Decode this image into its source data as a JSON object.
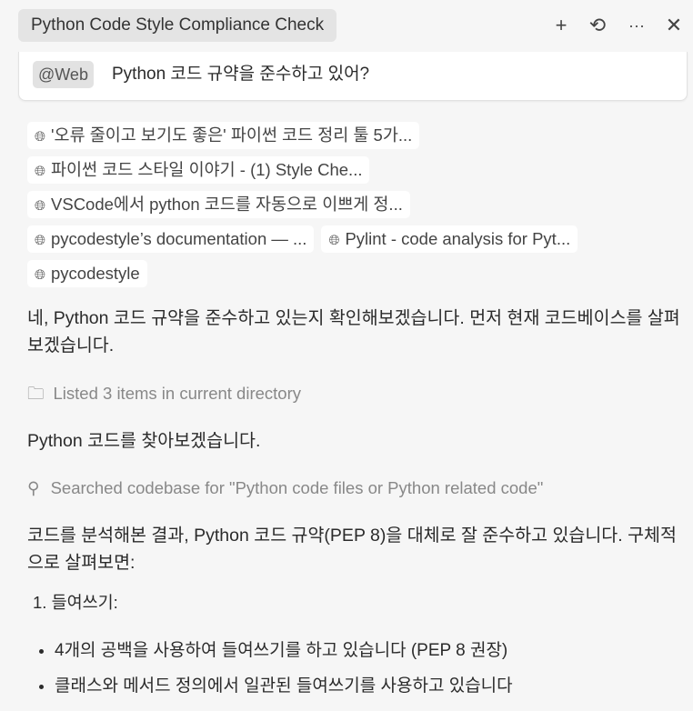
{
  "header": {
    "title": "Python Code Style Compliance Check",
    "icons": [
      "plus-icon",
      "history-icon",
      "more-icon",
      "close-icon"
    ]
  },
  "input": {
    "mention": "@Web",
    "query": "Python 코드 규약을 준수하고 있어?"
  },
  "sources": [
    "'오류 줄이고 보기도 좋은' 파이썬 코드 정리 툴 5가...",
    "파이썬 코드 스타일 이야기 - (1) Style Che...",
    "VSCode에서 python 코드를 자동으로 이쁘게 정...",
    "pycodestyle’s documentation — ...",
    "Pylint - code analysis for Pyt...",
    "pycodestyle"
  ],
  "messages": {
    "intro": "네, Python 코드 규약을 준수하고 있는지 확인해보겠습니다. 먼저 현재 코드베이스를 살펴보겠습니다.",
    "listed": "Listed 3 items in current directory",
    "find": "Python 코드를 찾아보겠습니다.",
    "searched": "Searched codebase for \"Python code files or Python related code\"",
    "result": "코드를 분석해본 결과, Python 코드 규약(PEP 8)을 대체로 잘 준수하고 있습니다. 구체적으로 살펴보면:",
    "item1": "1. 들여쓰기:",
    "bullets": [
      "4개의 공백을 사용하여 들여쓰기를 하고 있습니다 (PEP 8 권장)",
      "클래스와 메서드 정의에서 일관된 들여쓰기를 사용하고 있습니다"
    ]
  }
}
